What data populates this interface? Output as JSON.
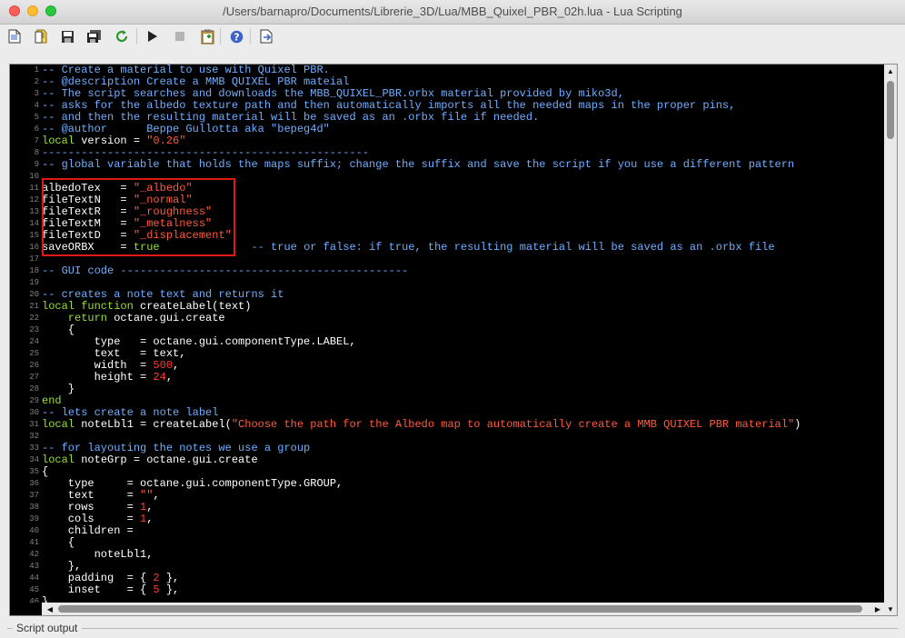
{
  "window": {
    "title": "/Users/barnapro/Documents/Librerie_3D/Lua/MBB_Quixel_PBR_02h.lua - Lua Scripting"
  },
  "toolbar": {
    "buttons": [
      "new-document",
      "open-document",
      "save",
      "save-all",
      "reload",
      "run",
      "stop",
      "paste-clipboard",
      "help",
      "export"
    ]
  },
  "editor": {
    "lines": [
      {
        "n": "1",
        "segs": [
          {
            "c": "com",
            "t": "-- Create a material to use with Quixel PBR."
          }
        ]
      },
      {
        "n": "2",
        "segs": [
          {
            "c": "com",
            "t": "-- @description Create a MMB QUIXEL PBR mateial"
          }
        ]
      },
      {
        "n": "3",
        "segs": [
          {
            "c": "com",
            "t": "-- The script searches and downloads the MBB_QUIXEL_PBR.orbx material provided by miko3d,"
          }
        ]
      },
      {
        "n": "4",
        "segs": [
          {
            "c": "com",
            "t": "-- asks for the albedo texture path and then automatically imports all the needed maps in the proper pins,"
          }
        ]
      },
      {
        "n": "5",
        "segs": [
          {
            "c": "com",
            "t": "-- and then the resulting material will be saved as an .orbx file if needed."
          }
        ]
      },
      {
        "n": "6",
        "segs": [
          {
            "c": "com",
            "t": "-- @author      Beppe Gullotta aka \"bepeg4d\""
          }
        ]
      },
      {
        "n": "7",
        "segs": [
          {
            "c": "kw",
            "t": "local"
          },
          {
            "c": "id",
            "t": " version = "
          },
          {
            "c": "str",
            "t": "\"0.26\""
          }
        ]
      },
      {
        "n": "8",
        "segs": [
          {
            "c": "com",
            "t": "--------------------------------------------------"
          }
        ]
      },
      {
        "n": "9",
        "segs": [
          {
            "c": "com",
            "t": "-- global variable that holds the maps suffix; change the suffix and save the script if you use a different pattern"
          }
        ]
      },
      {
        "n": "10",
        "segs": []
      },
      {
        "n": "11",
        "segs": [
          {
            "c": "id",
            "t": "albedoTex   = "
          },
          {
            "c": "str",
            "t": "\"_albedo\""
          }
        ]
      },
      {
        "n": "12",
        "segs": [
          {
            "c": "id",
            "t": "fileTextN   = "
          },
          {
            "c": "str",
            "t": "\"_normal\""
          }
        ]
      },
      {
        "n": "13",
        "segs": [
          {
            "c": "id",
            "t": "fileTextR   = "
          },
          {
            "c": "str",
            "t": "\"_roughness\""
          }
        ]
      },
      {
        "n": "14",
        "segs": [
          {
            "c": "id",
            "t": "fileTextM   = "
          },
          {
            "c": "str",
            "t": "\"_metalness\""
          }
        ]
      },
      {
        "n": "15",
        "segs": [
          {
            "c": "id",
            "t": "fileTextD   = "
          },
          {
            "c": "str",
            "t": "\"_displacement\""
          }
        ]
      },
      {
        "n": "16",
        "segs": [
          {
            "c": "id",
            "t": "saveORBX    = "
          },
          {
            "c": "kw",
            "t": "true"
          },
          {
            "c": "com",
            "t": "              -- true or false: if true, the resulting material will be saved as an .orbx file"
          }
        ]
      },
      {
        "n": "17",
        "segs": []
      },
      {
        "n": "18",
        "segs": [
          {
            "c": "com",
            "t": "-- GUI code --------------------------------------------"
          }
        ]
      },
      {
        "n": "19",
        "segs": []
      },
      {
        "n": "20",
        "segs": [
          {
            "c": "com",
            "t": "-- creates a note text and returns it"
          }
        ]
      },
      {
        "n": "21",
        "segs": [
          {
            "c": "kw",
            "t": "local function"
          },
          {
            "c": "id",
            "t": " createLabel(text)"
          }
        ]
      },
      {
        "n": "22",
        "segs": [
          {
            "c": "kw",
            "t": "    return"
          },
          {
            "c": "id",
            "t": " octane.gui.create"
          }
        ]
      },
      {
        "n": "23",
        "segs": [
          {
            "c": "id",
            "t": "    {"
          }
        ]
      },
      {
        "n": "24",
        "segs": [
          {
            "c": "id",
            "t": "        type   = octane.gui.componentType.LABEL,"
          }
        ]
      },
      {
        "n": "25",
        "segs": [
          {
            "c": "id",
            "t": "        text   = text,"
          }
        ]
      },
      {
        "n": "26",
        "segs": [
          {
            "c": "id",
            "t": "        width  = "
          },
          {
            "c": "num",
            "t": "500"
          },
          {
            "c": "id",
            "t": ","
          }
        ]
      },
      {
        "n": "27",
        "segs": [
          {
            "c": "id",
            "t": "        height = "
          },
          {
            "c": "num",
            "t": "24"
          },
          {
            "c": "id",
            "t": ","
          }
        ]
      },
      {
        "n": "28",
        "segs": [
          {
            "c": "id",
            "t": "    }"
          }
        ]
      },
      {
        "n": "29",
        "segs": [
          {
            "c": "kw",
            "t": "end"
          }
        ]
      },
      {
        "n": "30",
        "segs": [
          {
            "c": "com",
            "t": "-- lets create a note label"
          }
        ]
      },
      {
        "n": "31",
        "segs": [
          {
            "c": "kw",
            "t": "local"
          },
          {
            "c": "id",
            "t": " noteLbl1 = createLabel("
          },
          {
            "c": "str",
            "t": "\"Choose the path for the Albedo map to automatically create a MMB QUIXEL PBR material\""
          },
          {
            "c": "id",
            "t": ")"
          }
        ]
      },
      {
        "n": "32",
        "segs": []
      },
      {
        "n": "33",
        "segs": [
          {
            "c": "com",
            "t": "-- for layouting the notes we use a group"
          }
        ]
      },
      {
        "n": "34",
        "segs": [
          {
            "c": "kw",
            "t": "local"
          },
          {
            "c": "id",
            "t": " noteGrp = octane.gui.create"
          }
        ]
      },
      {
        "n": "35",
        "segs": [
          {
            "c": "id",
            "t": "{"
          }
        ]
      },
      {
        "n": "36",
        "segs": [
          {
            "c": "id",
            "t": "    type     = octane.gui.componentType.GROUP,"
          }
        ]
      },
      {
        "n": "37",
        "segs": [
          {
            "c": "id",
            "t": "    text     = "
          },
          {
            "c": "str",
            "t": "\"\""
          },
          {
            "c": "id",
            "t": ","
          }
        ]
      },
      {
        "n": "38",
        "segs": [
          {
            "c": "id",
            "t": "    rows     = "
          },
          {
            "c": "num",
            "t": "1"
          },
          {
            "c": "id",
            "t": ","
          }
        ]
      },
      {
        "n": "39",
        "segs": [
          {
            "c": "id",
            "t": "    cols     = "
          },
          {
            "c": "num",
            "t": "1"
          },
          {
            "c": "id",
            "t": ","
          }
        ]
      },
      {
        "n": "40",
        "segs": [
          {
            "c": "id",
            "t": "    children ="
          }
        ]
      },
      {
        "n": "41",
        "segs": [
          {
            "c": "id",
            "t": "    {"
          }
        ]
      },
      {
        "n": "42",
        "segs": [
          {
            "c": "id",
            "t": "        noteLbl1,"
          }
        ]
      },
      {
        "n": "43",
        "segs": [
          {
            "c": "id",
            "t": "    },"
          }
        ]
      },
      {
        "n": "44",
        "segs": [
          {
            "c": "id",
            "t": "    padding  = { "
          },
          {
            "c": "num",
            "t": "2"
          },
          {
            "c": "id",
            "t": " },"
          }
        ]
      },
      {
        "n": "45",
        "segs": [
          {
            "c": "id",
            "t": "    inset    = { "
          },
          {
            "c": "num",
            "t": "5"
          },
          {
            "c": "id",
            "t": " },"
          }
        ]
      },
      {
        "n": "46",
        "segs": [
          {
            "c": "id",
            "t": "}"
          }
        ]
      }
    ]
  },
  "output": {
    "label": "Script output"
  }
}
